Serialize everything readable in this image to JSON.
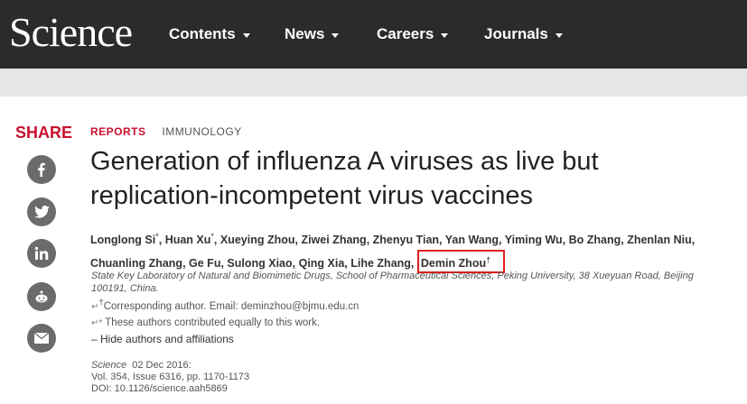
{
  "header": {
    "logo": "Science",
    "nav": [
      {
        "label": "Contents"
      },
      {
        "label": "News"
      },
      {
        "label": "Careers"
      },
      {
        "label": "Journals"
      }
    ]
  },
  "share": {
    "label": "SHARE",
    "buttons": [
      "facebook-icon",
      "twitter-icon",
      "linkedin-icon",
      "reddit-icon",
      "email-icon"
    ]
  },
  "article": {
    "section": "REPORTS",
    "subject": "IMMUNOLOGY",
    "title": "Generation of influenza A viruses as live but replication-incompetent virus vaccines",
    "authors": [
      {
        "name": "Longlong Si",
        "mark": "*"
      },
      {
        "name": "Huan Xu",
        "mark": "*"
      },
      {
        "name": "Xueying Zhou",
        "mark": ""
      },
      {
        "name": "Ziwei Zhang",
        "mark": ""
      },
      {
        "name": "Zhenyu Tian",
        "mark": ""
      },
      {
        "name": "Yan Wang",
        "mark": ""
      },
      {
        "name": "Yiming Wu",
        "mark": ""
      },
      {
        "name": "Bo Zhang",
        "mark": ""
      },
      {
        "name": "Zhenlan Niu",
        "mark": ""
      },
      {
        "name": "Chuanling Zhang",
        "mark": ""
      },
      {
        "name": "Ge Fu",
        "mark": ""
      },
      {
        "name": "Sulong Xiao",
        "mark": ""
      },
      {
        "name": "Qing Xia",
        "mark": ""
      },
      {
        "name": "Lihe Zhang",
        "mark": ""
      }
    ],
    "highlighted_author": {
      "name": "Demin Zhou",
      "mark": "†"
    },
    "affiliation": "State Key Laboratory of Natural and Biomimetic Drugs, School of Pharmaceutical Sciences, Peking University, 38 Xueyuan Road, Beijing 100191, China.",
    "corresponding_prefix": "Corresponding author. Email: ",
    "corresponding_email": "deminzhou@bjmu.edu.cn",
    "corresponding_mark": "†",
    "equal_note": "These authors contributed equally to this work.",
    "hide_link": "– Hide authors and affiliations",
    "citation": {
      "journal": "Science",
      "date": "02 Dec 2016:",
      "volume": "Vol. 354, Issue 6316, pp. 1170-1173",
      "doi": "DOI: 10.1126/science.aah5869"
    }
  }
}
